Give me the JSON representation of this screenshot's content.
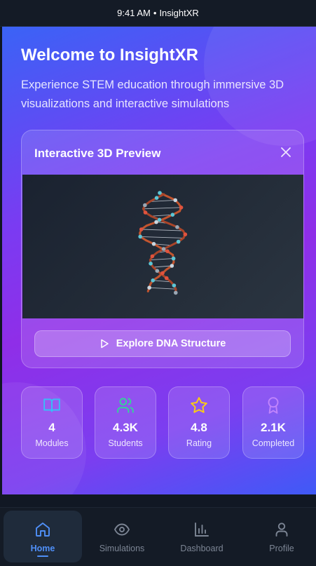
{
  "status_bar": {
    "time": "9:41 AM",
    "separator": "•",
    "app_name": "InsightXR"
  },
  "hero": {
    "title": "Welcome to InsightXR",
    "description": "Experience STEM education through immersive 3D visualizations and interactive simulations"
  },
  "preview": {
    "title": "Interactive 3D Preview",
    "close_icon": "close-icon",
    "model": "dna-helix",
    "button_icon": "play-icon",
    "button_label": "Explore DNA Structure"
  },
  "stats": [
    {
      "icon": "book-icon",
      "color": "#38bdf8",
      "value": "4",
      "label": "Modules"
    },
    {
      "icon": "users-icon",
      "color": "#34d399",
      "value": "4.3K",
      "label": "Students"
    },
    {
      "icon": "star-icon",
      "color": "#facc15",
      "value": "4.8",
      "label": "Rating"
    },
    {
      "icon": "award-icon",
      "color": "#c084fc",
      "value": "2.1K",
      "label": "Completed"
    }
  ],
  "nav": {
    "active": "Home",
    "items": [
      {
        "icon": "home-icon",
        "label": "Home"
      },
      {
        "icon": "eye-icon",
        "label": "Simulations"
      },
      {
        "icon": "bar-chart-icon",
        "label": "Dashboard"
      },
      {
        "icon": "user-icon",
        "label": "Profile"
      }
    ]
  },
  "colors": {
    "accent": "#4f8ff7",
    "gradient_start": "#3a63f6",
    "gradient_mid": "#8f2ee8"
  }
}
